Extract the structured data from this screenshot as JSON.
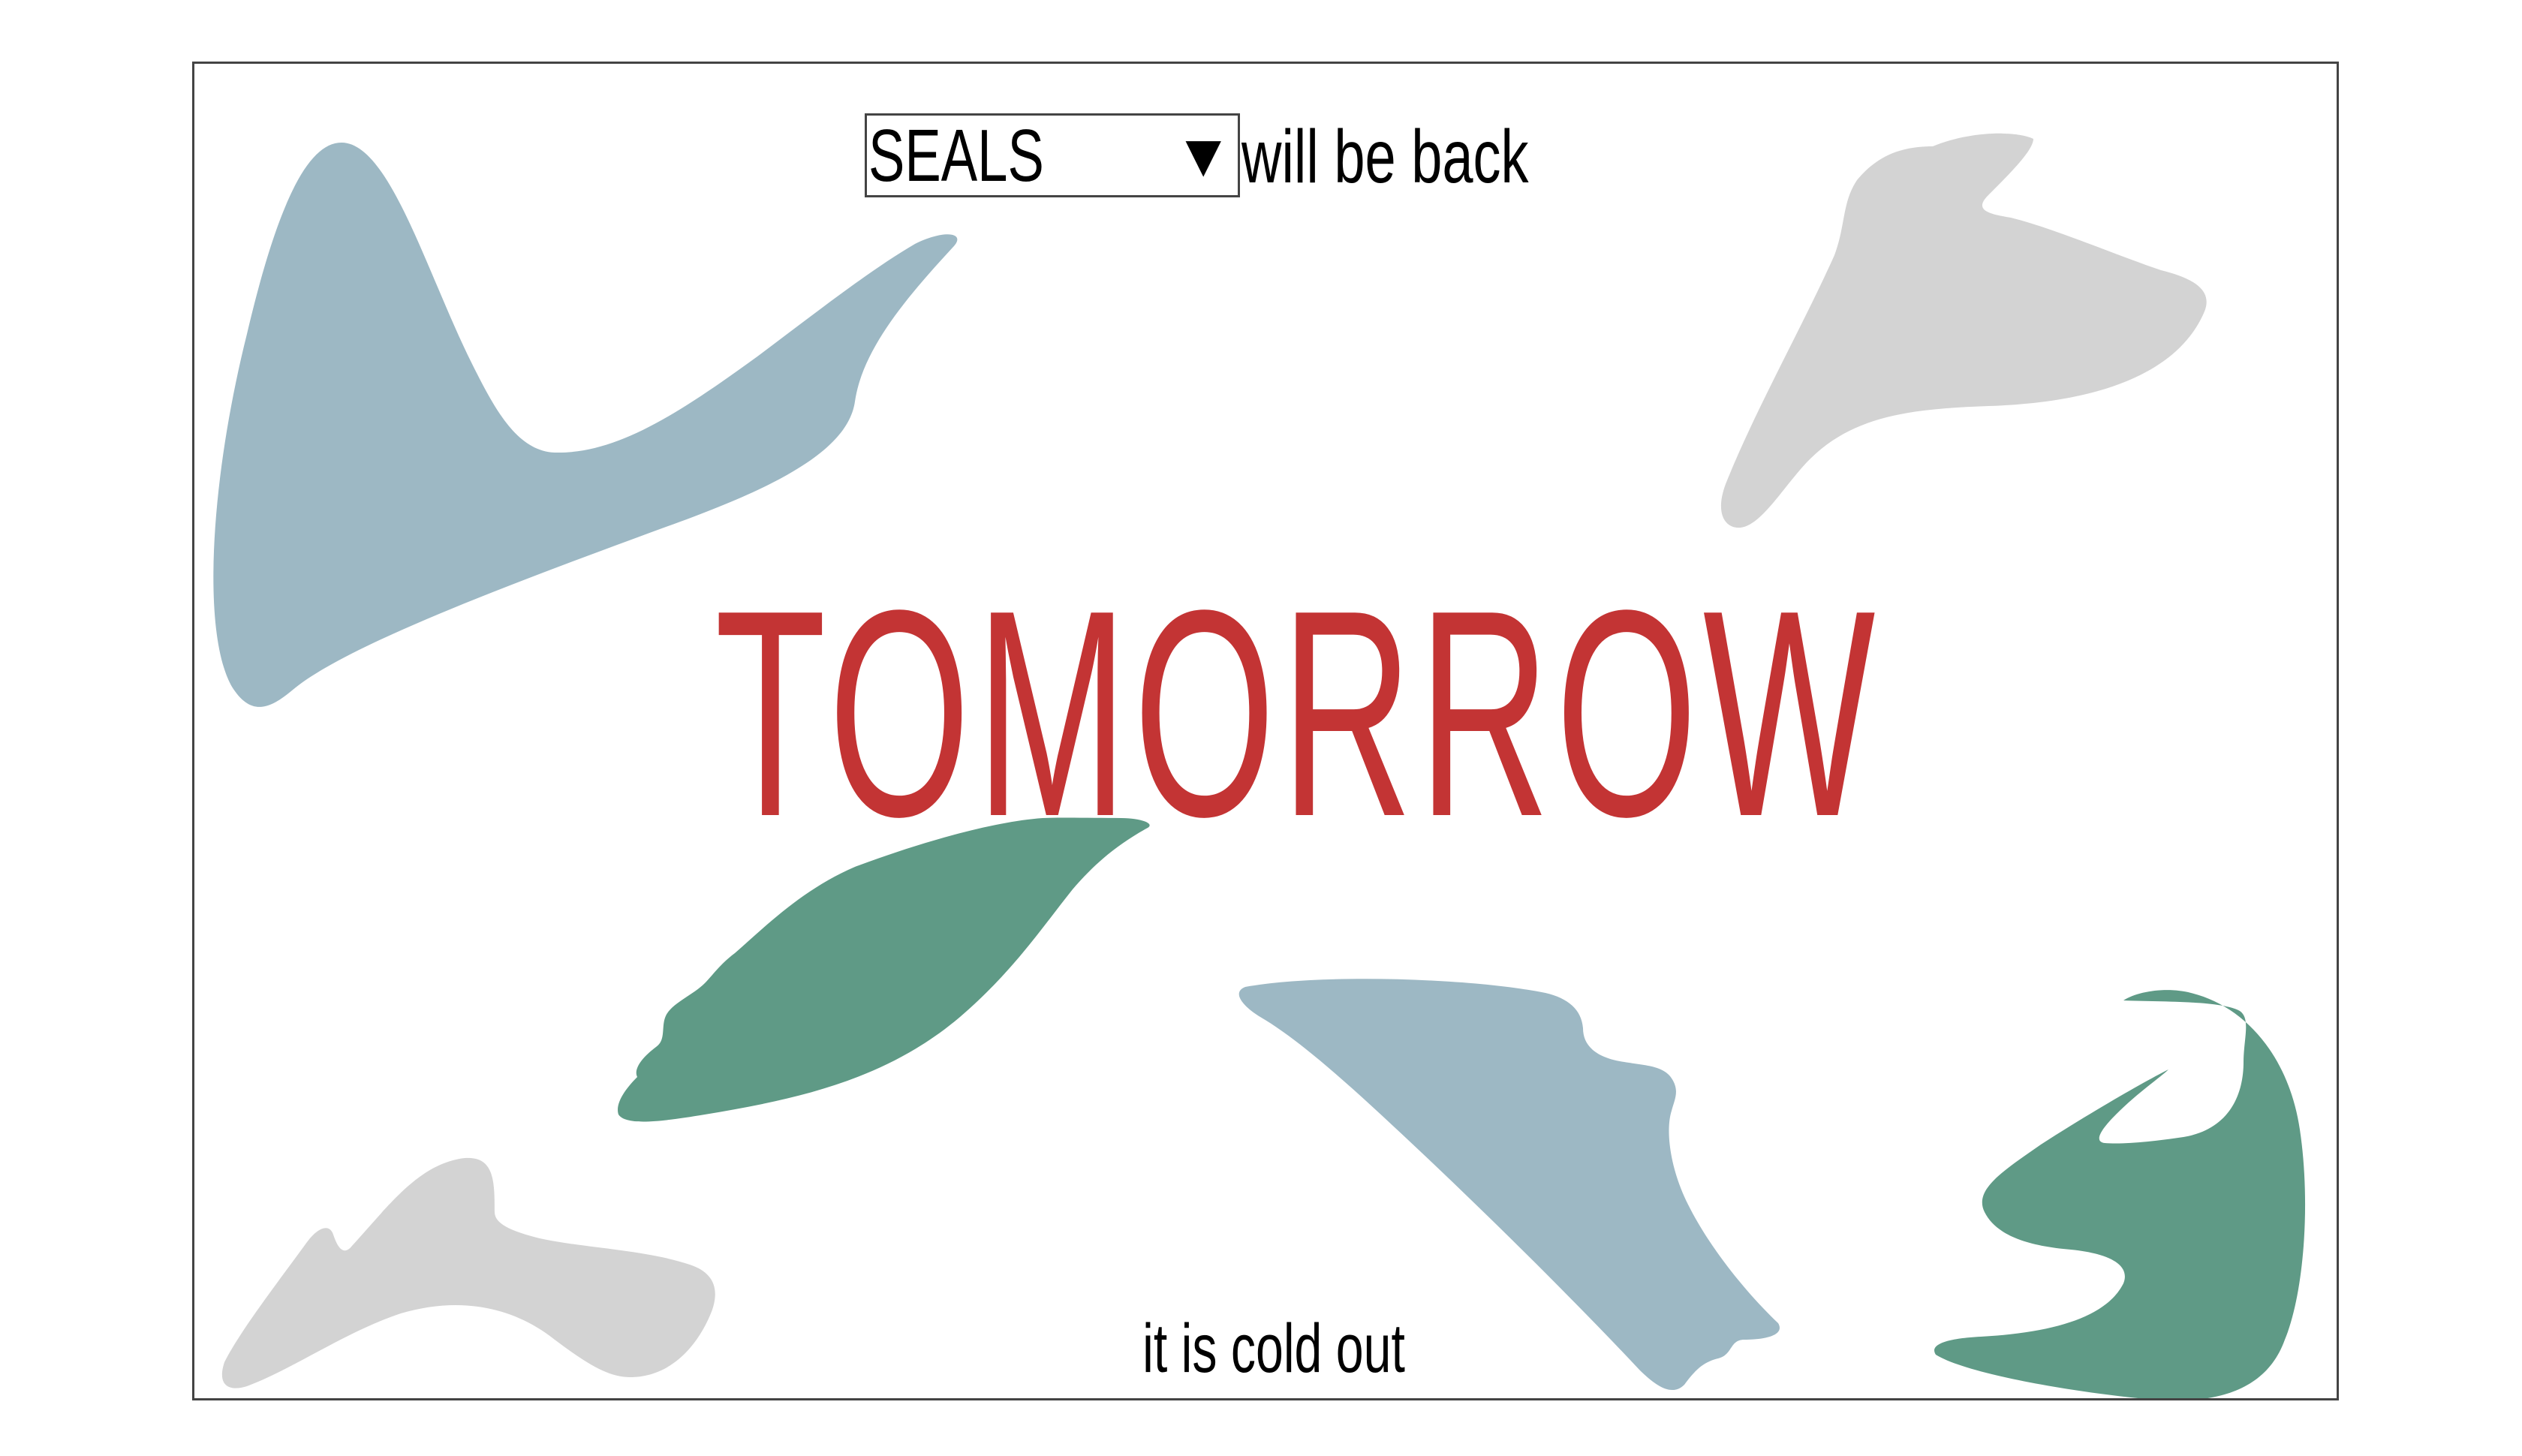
{
  "dropdown": {
    "selected": "SEALS",
    "chevron_glyph": "▼"
  },
  "header": {
    "tail": "will be back"
  },
  "headline": "TOMORROW",
  "footer": "it is cold out",
  "colors": {
    "headline": "#c33434",
    "blue_shape": "#9db8c4",
    "green_shape": "#5f9a86",
    "grey_shape": "#d3d3d3",
    "border": "#444444",
    "text": "#000000"
  }
}
